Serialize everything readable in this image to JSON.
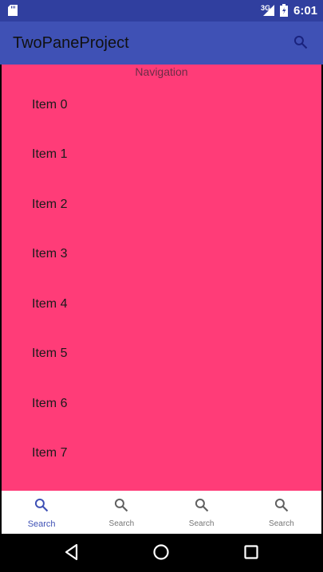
{
  "status_bar": {
    "network": "3G",
    "time": "6:01"
  },
  "app_bar": {
    "title": "TwoPaneProject",
    "search_icon": "search-icon"
  },
  "content": {
    "section_label": "Navigation",
    "background_color": "#FF3C78",
    "items": [
      {
        "label": "Item 0"
      },
      {
        "label": "Item 1"
      },
      {
        "label": "Item 2"
      },
      {
        "label": "Item 3"
      },
      {
        "label": "Item 4"
      },
      {
        "label": "Item 5"
      },
      {
        "label": "Item 6"
      },
      {
        "label": "Item 7"
      }
    ]
  },
  "bottom_nav": {
    "items": [
      {
        "label": "Search",
        "icon": "search-icon",
        "active": true
      },
      {
        "label": "Search",
        "icon": "search-icon",
        "active": false
      },
      {
        "label": "Search",
        "icon": "search-icon",
        "active": false
      },
      {
        "label": "Search",
        "icon": "search-icon",
        "active": false
      }
    ]
  },
  "colors": {
    "primary": "#3F51B5",
    "primary_dark": "#303F9F",
    "accent_pink": "#FF3C78"
  }
}
